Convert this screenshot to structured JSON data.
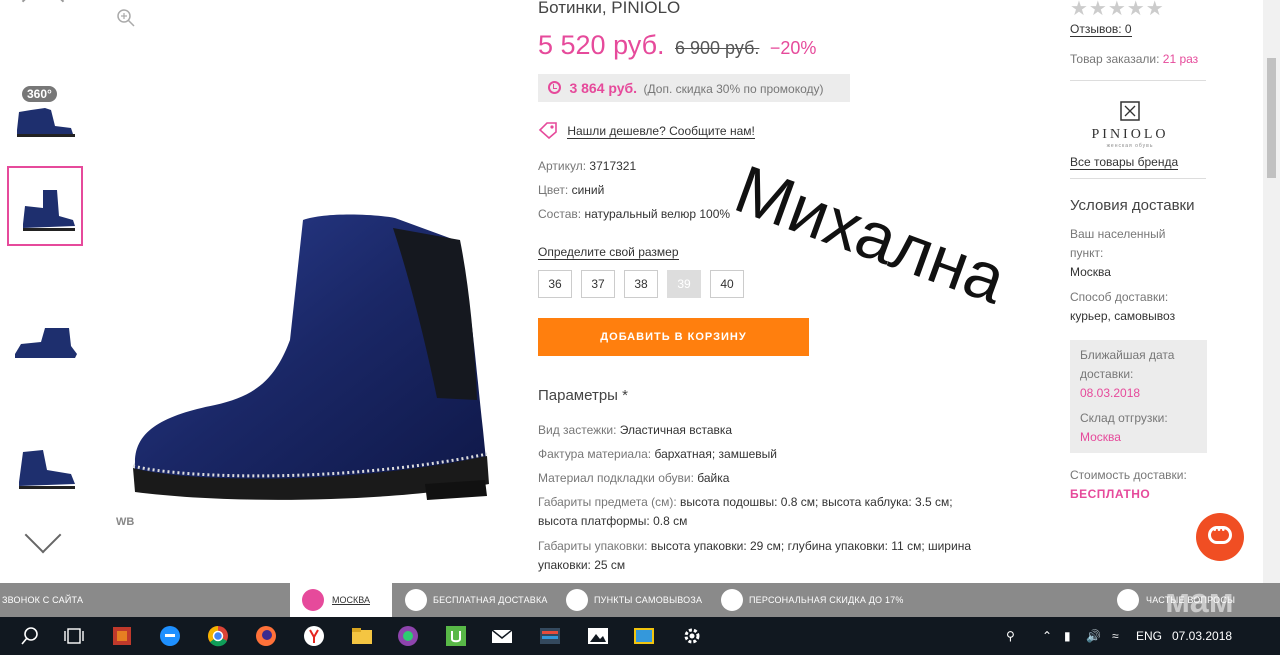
{
  "product": {
    "title": "Ботинки, PINIOLO",
    "price": "5 520 руб.",
    "old_price": "6 900 руб.",
    "discount": "−20%",
    "promo_price": "3 864 руб.",
    "promo_note": "(Доп. скидка 30% по промокоду)",
    "cheaper_link": "Нашли дешевле? Сообщите нам!",
    "article_label": "Артикул:",
    "article_value": "3717321",
    "color_label": "Цвет:",
    "color_value": "синий",
    "composition_label": "Состав:",
    "composition_value": "натуральный велюр 100%",
    "size_link": "Определите свой размер",
    "sizes": [
      "36",
      "37",
      "38",
      "39",
      "40"
    ],
    "disabled_size": "39",
    "cart_button": "ДОБАВИТЬ В КОРЗИНУ",
    "params_title": "Параметры *",
    "params": [
      {
        "label": "Вид застежки:",
        "value": "Эластичная вставка"
      },
      {
        "label": "Фактура материала:",
        "value": "бархатная; замшевый"
      },
      {
        "label": "Материал подкладки обуви:",
        "value": "байка"
      },
      {
        "label": "Габариты предмета (см):",
        "value": "высота подошвы: 0.8 см; высота каблука: 3.5 см; высота платформы: 0.8 см"
      },
      {
        "label": "Габариты упаковки:",
        "value": "высота упаковки: 29 см; глубина упаковки: 11 см; ширина упаковки: 25 см"
      }
    ]
  },
  "gallery": {
    "badge_360": "360°",
    "wb_label": "WB"
  },
  "overlay_text": "Михална",
  "right": {
    "reviews": "Отзывов: 0",
    "ordered_label": "Товар заказали:",
    "ordered_value": "21 раз",
    "brand_name": "PINIOLO",
    "brand_sub": "женская обувь",
    "all_brand_link": "Все товары бренда",
    "delivery_title": "Условия доставки",
    "locality_label_1": "Ваш населенный",
    "locality_label_2": "пункт:",
    "locality_value": "Москва",
    "method_label": "Способ доставки:",
    "method_value": "курьер, самовывоз",
    "nearest_label_1": "Ближайшая дата",
    "nearest_label_2": "доставки:",
    "nearest_value": "08.03.2018",
    "warehouse_label": "Склад отгрузки:",
    "warehouse_value": "Москва",
    "cost_label": "Стоимость доставки:",
    "cost_value": "БЕСПЛАТНО"
  },
  "infobar": {
    "call": "ЗВОНОК С САЙТА",
    "city": "МОСКВА",
    "free_delivery": "БЕСПЛАТНАЯ ДОСТАВКА",
    "pickup": "ПУНКТЫ САМОВЫВОЗА",
    "personal_discount": "ПЕРСОНАЛЬНАЯ СКИДКА ДО 17%",
    "faq": "ЧАСТЫЕ ВОПРОСЫ"
  },
  "watermark": "мам",
  "taskbar": {
    "lang": "ENG",
    "time": "07.03.2018"
  },
  "colors": {
    "accent_pink": "#e64a9b",
    "cart_orange": "#ff7f0e",
    "chat_red": "#f04e23"
  }
}
